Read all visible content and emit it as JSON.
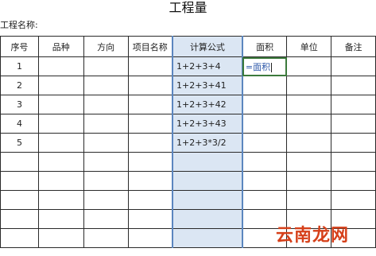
{
  "title": "工程量",
  "project_label": "工程名称:",
  "headers": [
    "序号",
    "品种",
    "方向",
    "项目名称",
    "计算公式",
    "面积",
    "单位",
    "备注"
  ],
  "rows": [
    {
      "seq": "1",
      "formula": "1+2+3+4",
      "area": "=面积"
    },
    {
      "seq": "2",
      "formula": "1+2+3+41",
      "area": ""
    },
    {
      "seq": "3",
      "formula": "1+2+3+42",
      "area": ""
    },
    {
      "seq": "4",
      "formula": "1+2+3+43",
      "area": ""
    },
    {
      "seq": "5",
      "formula": "1+2+3*3/2",
      "area": ""
    },
    {
      "seq": "",
      "formula": "",
      "area": ""
    },
    {
      "seq": "",
      "formula": "",
      "area": ""
    },
    {
      "seq": "",
      "formula": "",
      "area": ""
    },
    {
      "seq": "",
      "formula": "",
      "area": ""
    },
    {
      "seq": "",
      "formula": "",
      "area": ""
    }
  ],
  "watermark": "云南龙网"
}
